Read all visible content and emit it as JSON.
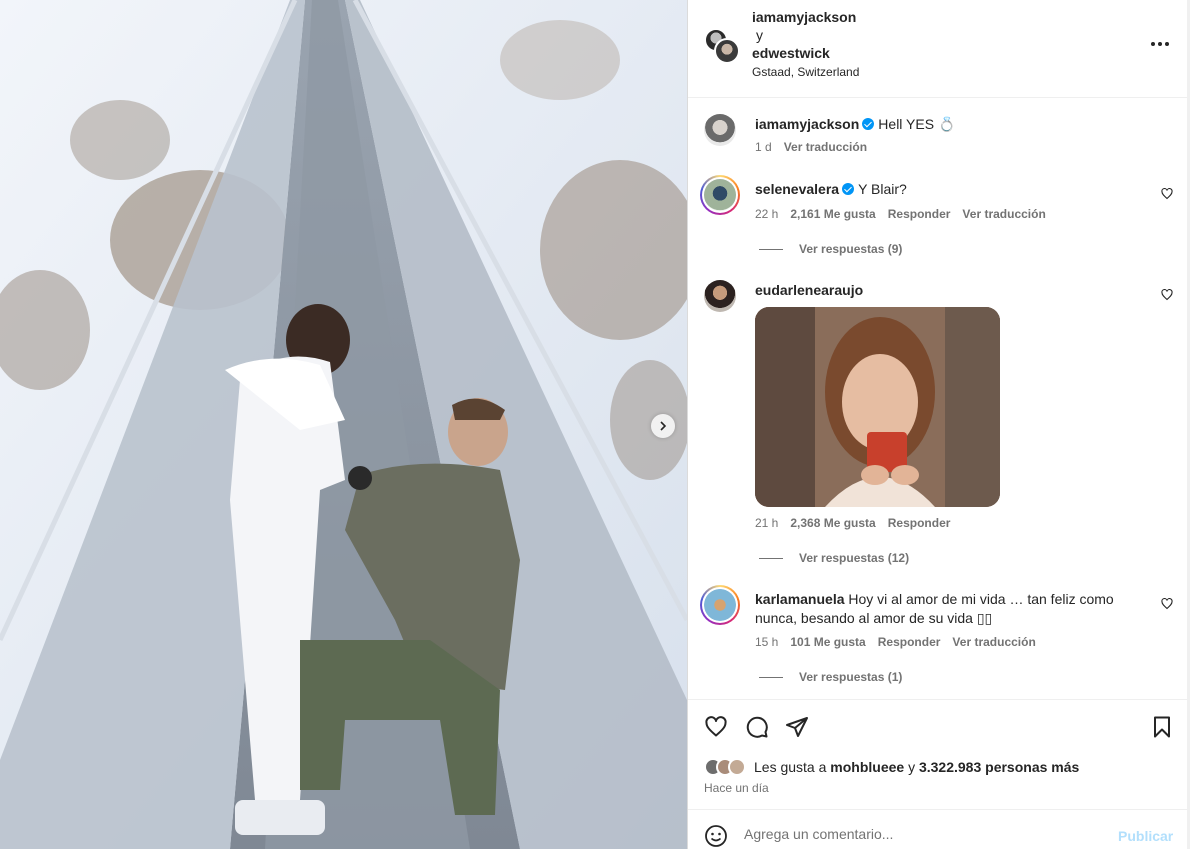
{
  "post": {
    "next_icon": "chevron-right-icon"
  },
  "header": {
    "user1": "iamamyjackson",
    "connector": "y",
    "user2": "edwestwick",
    "location": "Gstaad, Switzerland",
    "more_icon": "more-horizontal-icon"
  },
  "caption": {
    "username": "iamamyjackson",
    "text": "Hell YES 💍",
    "time": "1 d",
    "translate": "Ver traducción"
  },
  "comments": [
    {
      "username": "selenevalera",
      "verified": true,
      "text": "Y Blair?",
      "time": "22 h",
      "likes": "2,161 Me gusta",
      "reply": "Responder",
      "translate": "Ver traducción",
      "replies": "Ver respuestas (9)"
    },
    {
      "username": "eudarlenearaujo",
      "verified": false,
      "text": "",
      "time": "21 h",
      "likes": "2,368 Me gusta",
      "reply": "Responder",
      "replies": "Ver respuestas (12)"
    },
    {
      "username": "karlamanuela",
      "verified": false,
      "text_line1": "Hoy vi al amor de mi vida … tan feliz como",
      "text_line2": "nunca, besando al amor de su vida ▯▯",
      "time": "15 h",
      "likes": "101 Me gusta",
      "reply": "Responder",
      "translate": "Ver traducción",
      "replies": "Ver respuestas (1)"
    }
  ],
  "actions": {
    "like_icon": "heart-icon",
    "comment_icon": "comment-icon",
    "share_icon": "send-icon",
    "save_icon": "bookmark-icon"
  },
  "likes": {
    "prefix": "Les gusta a",
    "user": "mohblueee",
    "connector": "y",
    "others": "3.322.983 personas más"
  },
  "posted_ago": "Hace un día",
  "comment_box": {
    "placeholder": "Agrega un comentario...",
    "publish": "Publicar",
    "emoji_icon": "smiley-icon"
  }
}
